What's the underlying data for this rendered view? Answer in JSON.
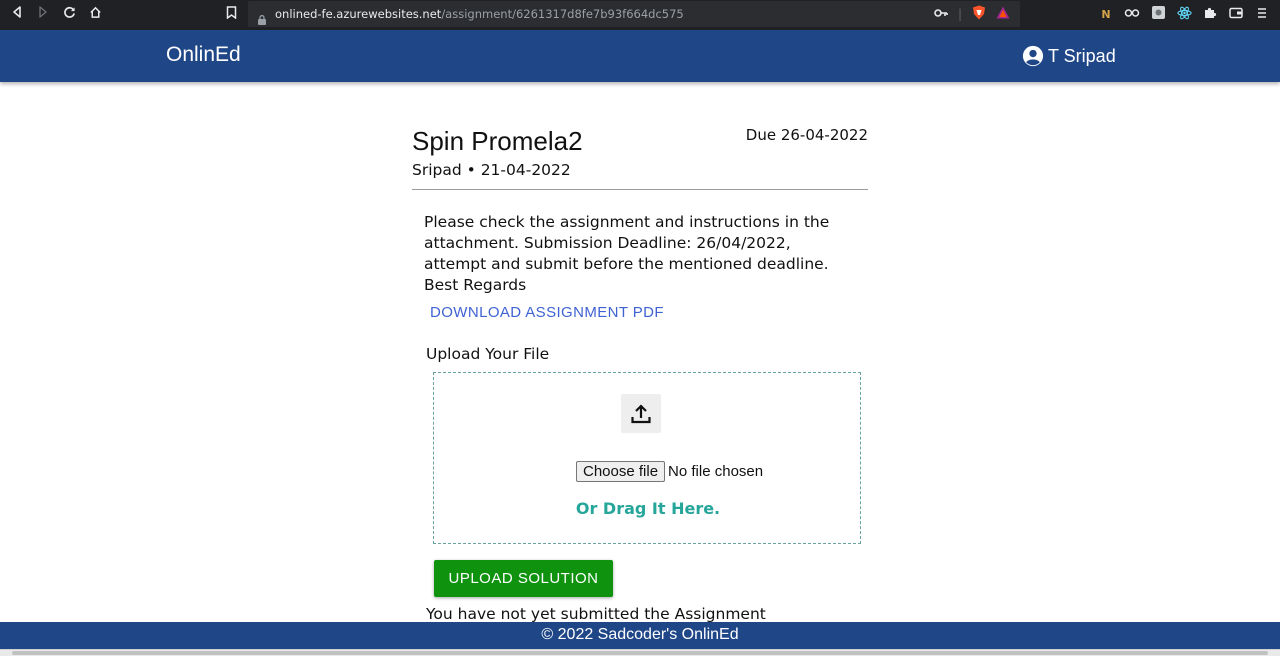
{
  "browser": {
    "url_host": "onlined-fe.azurewebsites.net",
    "url_path": "/assignment/6261317d8fe7b93f664dc575"
  },
  "header": {
    "brand": "OnlinEd",
    "user_name": "T Sripad"
  },
  "assignment": {
    "title": "Spin Promela2",
    "due": "Due 26-04-2022",
    "meta": "Sripad • 21-04-2022",
    "description": "Please check the assignment and instructions in the attachment. Submission Deadline: 26/04/2022, attempt and submit before the mentioned deadline. Best Regards",
    "download_label": "DOWNLOAD ASSIGNMENT PDF"
  },
  "upload": {
    "label": "Upload Your File",
    "choose_file_label": "Choose file",
    "file_status": "No file chosen",
    "drag_hint": "Or Drag It Here.",
    "submit_label": "UPLOAD SOLUTION",
    "submission_status": "You have not yet submitted the Assignment"
  },
  "footer": {
    "text": "© 2022 Sadcoder's OnlinEd"
  },
  "icons": {
    "back": "back-icon",
    "forward": "forward-icon",
    "reload": "reload-icon",
    "home": "home-icon",
    "bookmark": "bookmark-icon",
    "lock": "lock-icon",
    "key": "key-icon",
    "brave": "brave-shield-icon",
    "rewards": "brave-rewards-icon",
    "user": "user-circle-icon",
    "upload": "upload-icon"
  },
  "colors": {
    "header_bg": "#1f4788",
    "link": "#3f63d3",
    "drag_hint": "#26a69a",
    "submit_bg": "#0f930f"
  }
}
